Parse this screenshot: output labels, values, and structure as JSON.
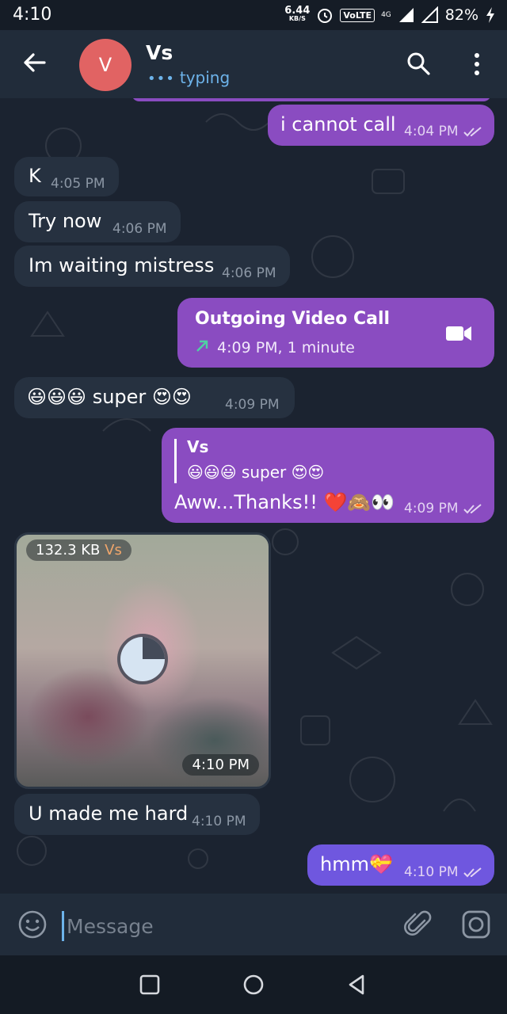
{
  "status_bar": {
    "time": "4:10",
    "net_speed_value": "6.44",
    "net_speed_unit": "KB/S",
    "volte": "VoLTE",
    "network": "4G",
    "battery": "82%"
  },
  "header": {
    "avatar_letter": "V",
    "title": "Vs",
    "status": "typing"
  },
  "messages": [
    {
      "direction": "out",
      "text": "i cannot call",
      "time": "4:04 PM"
    },
    {
      "direction": "in",
      "text": "K",
      "time": "4:05 PM"
    },
    {
      "direction": "in",
      "text": "Try now",
      "time": "4:06 PM"
    },
    {
      "direction": "in",
      "text": "Im waiting mistress",
      "time": "4:06 PM"
    },
    {
      "direction": "out",
      "type": "call",
      "title": "Outgoing Video Call",
      "detail": "4:09 PM, 1 minute"
    },
    {
      "direction": "in",
      "text": "😃😃😃 super 😍😍",
      "time": "4:09 PM"
    },
    {
      "direction": "out",
      "reply_name": "Vs",
      "reply_text": "😃😃😃 super 😍😍",
      "text": "Aww...Thanks!! ❤️🙈👀",
      "time": "4:09 PM"
    },
    {
      "direction": "in",
      "type": "media",
      "size": "132.3 KB",
      "sender": "Vs",
      "time": "4:10 PM"
    },
    {
      "direction": "in",
      "text": "U made me hard",
      "time": "4:10 PM"
    },
    {
      "direction": "out",
      "text": "hmm💝",
      "time": "4:10 PM"
    }
  ],
  "input": {
    "placeholder": "Message"
  },
  "colors": {
    "header_bg": "#212c3a",
    "chat_bg": "#1b2330",
    "incoming_bubble": "#263140",
    "outgoing_bubble": "#8a4cc1",
    "accent": "#6db3ea",
    "avatar": "#e16363"
  }
}
